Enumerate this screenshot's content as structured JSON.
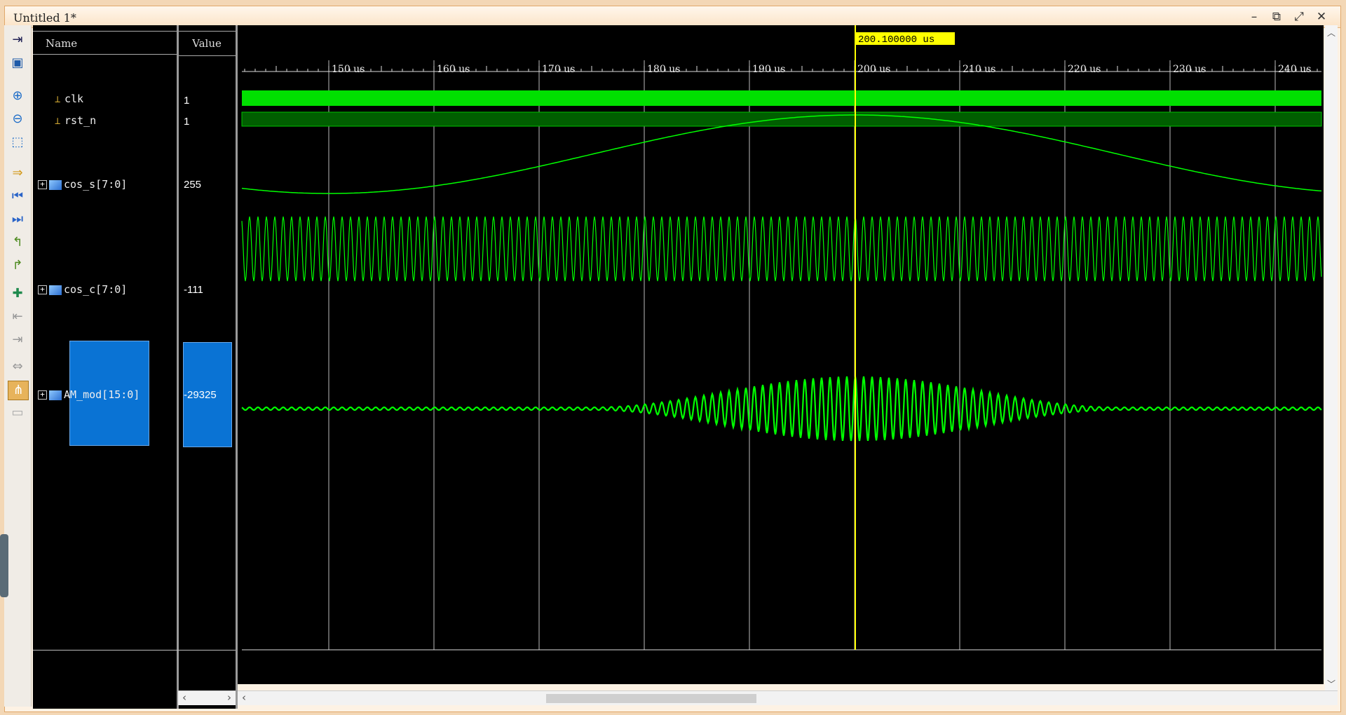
{
  "window": {
    "title": "Untitled 1*",
    "controls": [
      "–",
      "⧉",
      "⤢",
      "✕"
    ]
  },
  "columns": {
    "name": "Name",
    "value": "Value"
  },
  "signals": [
    {
      "name": "clk",
      "value": "1",
      "kind": "bit"
    },
    {
      "name": "rst_n",
      "value": "1",
      "kind": "bit"
    },
    {
      "name": "cos_s[7:0]",
      "value": "255",
      "kind": "bus-analog"
    },
    {
      "name": "cos_c[7:0]",
      "value": "-111",
      "kind": "bus-analog"
    },
    {
      "name": "AM_mod[15:0]",
      "value": "-29325",
      "kind": "bus-analog",
      "selected": true
    }
  ],
  "timeline": {
    "unit": "us",
    "ticks": [
      "150 us",
      "160 us",
      "170 us",
      "180 us",
      "190 us",
      "200 us",
      "210 us",
      "220 us",
      "230 us",
      "240 us"
    ],
    "cursor_label": "200.100000 us"
  },
  "colors": {
    "wave": "#00ff00",
    "bit_high": "#00e000",
    "cursor": "#ffff00",
    "background": "#000000",
    "selection": "#0a73d4"
  },
  "toolbar_icons": [
    "go-to-icon",
    "save-icon",
    "zoom-in-icon",
    "zoom-out-icon",
    "zoom-fit-icon",
    "cursor-to-icon",
    "go-start-icon",
    "go-end-icon",
    "prev-transition-icon",
    "next-transition-icon",
    "add-marker-icon",
    "prev-marker-icon",
    "next-marker-icon",
    "swap-cursors-icon",
    "snap-icon",
    "group-icon"
  ]
}
